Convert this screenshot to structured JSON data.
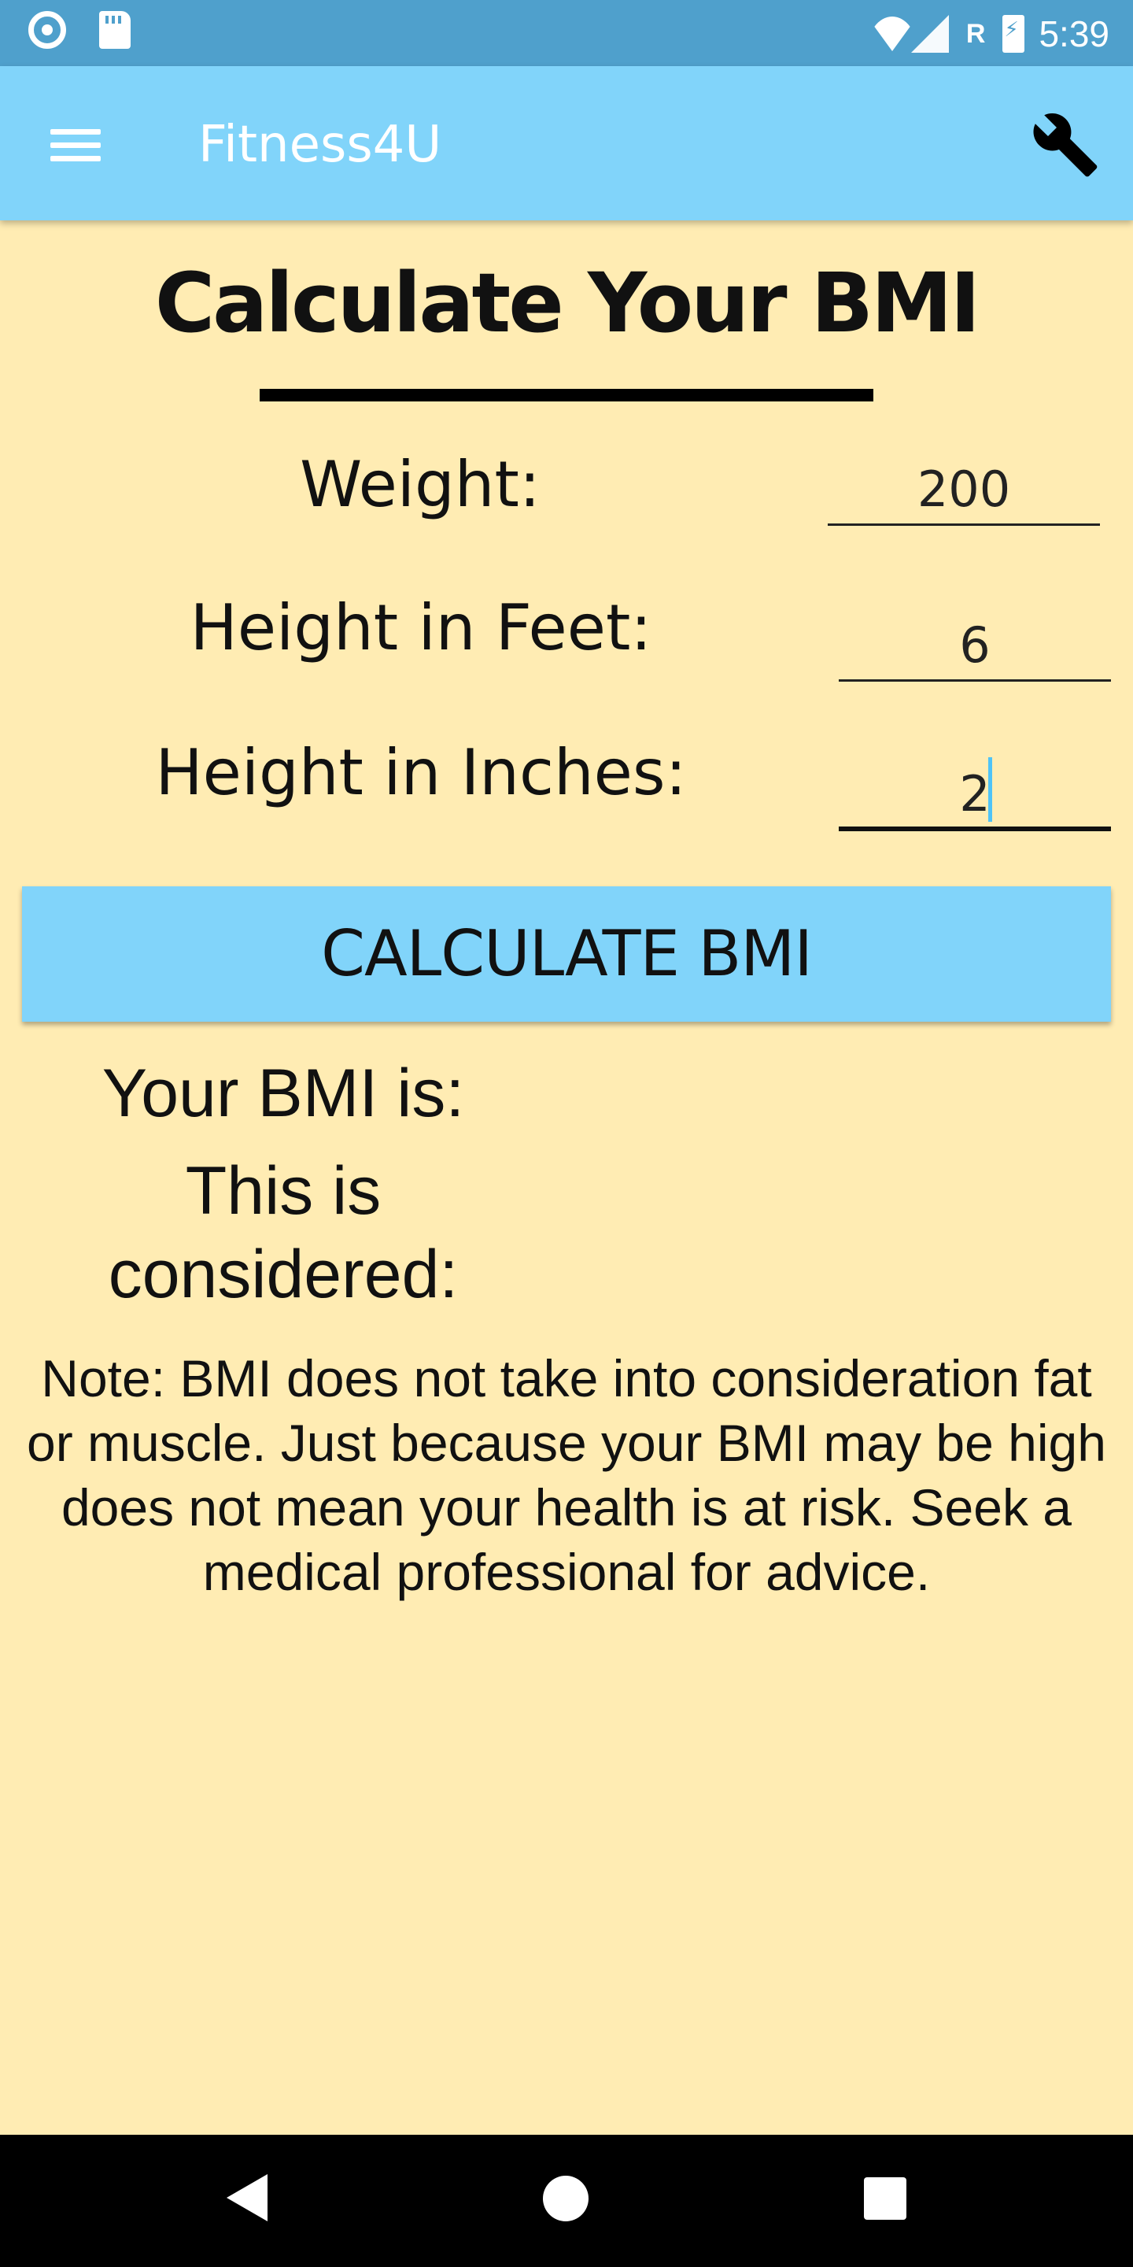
{
  "status_bar": {
    "time": "5:39",
    "roaming_indicator": "R",
    "icons": [
      "circle-notification-icon",
      "sd-card-icon",
      "wifi-off-icon",
      "cell-signal-icon",
      "battery-charging-icon"
    ]
  },
  "app_bar": {
    "title": "Fitness4U",
    "menu_icon": "hamburger-menu-icon",
    "settings_icon": "wrench-icon",
    "color": "#81D4FA"
  },
  "main": {
    "title": "Calculate Your BMI",
    "fields": {
      "weight": {
        "label": "Weight:",
        "value": "200"
      },
      "height_feet": {
        "label": "Height in Feet:",
        "value": "6"
      },
      "height_inches": {
        "label": "Height in Inches:",
        "value": "2"
      }
    },
    "calculate_button": "CALCULATE BMI",
    "result": {
      "bmi_label": "Your BMI is:",
      "category_label_line1": "This is",
      "category_label_line2": "considered:"
    },
    "note": "Note: BMI does not take into consideration fat or muscle. Just because your BMI may be high does not mean your health is at risk. Seek a medical professional for advice."
  },
  "nav_bar": {
    "icons": [
      "back-icon",
      "home-icon",
      "recents-icon"
    ]
  },
  "colors": {
    "background": "#FFECB3",
    "status_bar": "#4FA0CC",
    "accent": "#81D4FA",
    "cursor": "#4FC3F7"
  }
}
